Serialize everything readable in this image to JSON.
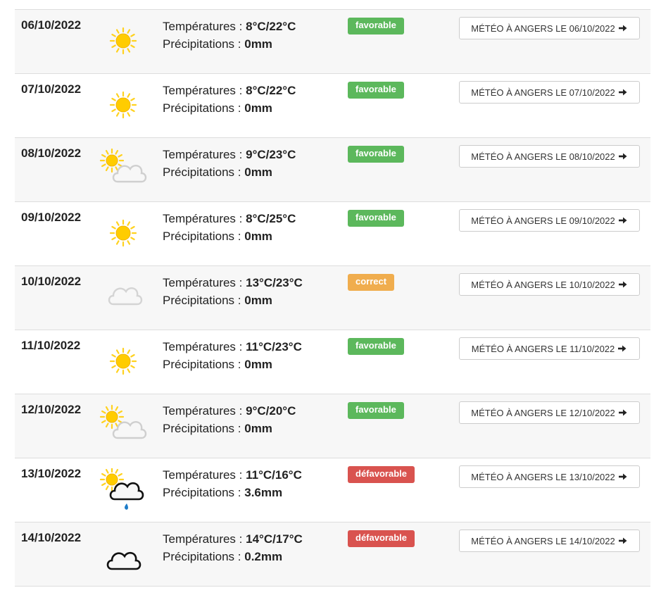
{
  "labels": {
    "temperatures": "Températures : ",
    "precipitations": "Précipitations : "
  },
  "colors": {
    "favorable": "#5cb85c",
    "correct": "#f0ad4e",
    "defavorable": "#d9534f",
    "sun": "#ffd21f",
    "rain": "#1e7cc8"
  },
  "rows": [
    {
      "date": "06/10/2022",
      "icon": "sun-icon",
      "temps": "8°C/22°C",
      "precip": "0mm",
      "status": "favorable",
      "status_label": "favorable",
      "button": "MÉTÉO À ANGERS LE 06/10/2022"
    },
    {
      "date": "07/10/2022",
      "icon": "sun-icon",
      "temps": "8°C/22°C",
      "precip": "0mm",
      "status": "favorable",
      "status_label": "favorable",
      "button": "MÉTÉO À ANGERS LE 07/10/2022"
    },
    {
      "date": "08/10/2022",
      "icon": "partly-cloudy-icon",
      "temps": "9°C/23°C",
      "precip": "0mm",
      "status": "favorable",
      "status_label": "favorable",
      "button": "MÉTÉO À ANGERS LE 08/10/2022"
    },
    {
      "date": "09/10/2022",
      "icon": "sun-icon",
      "temps": "8°C/25°C",
      "precip": "0mm",
      "status": "favorable",
      "status_label": "favorable",
      "button": "MÉTÉO À ANGERS LE 09/10/2022"
    },
    {
      "date": "10/10/2022",
      "icon": "light-cloud-icon",
      "temps": "13°C/23°C",
      "precip": "0mm",
      "status": "correct",
      "status_label": "correct",
      "button": "MÉTÉO À ANGERS LE 10/10/2022"
    },
    {
      "date": "11/10/2022",
      "icon": "sun-icon",
      "temps": "11°C/23°C",
      "precip": "0mm",
      "status": "favorable",
      "status_label": "favorable",
      "button": "MÉTÉO À ANGERS LE 11/10/2022"
    },
    {
      "date": "12/10/2022",
      "icon": "partly-cloudy-icon",
      "temps": "9°C/20°C",
      "precip": "0mm",
      "status": "favorable",
      "status_label": "favorable",
      "button": "MÉTÉO À ANGERS LE 12/10/2022"
    },
    {
      "date": "13/10/2022",
      "icon": "sun-rain-cloud-icon",
      "temps": "11°C/16°C",
      "precip": "3.6mm",
      "status": "defavorable",
      "status_label": "défavorable",
      "button": "MÉTÉO À ANGERS LE 13/10/2022"
    },
    {
      "date": "14/10/2022",
      "icon": "dark-cloud-icon",
      "temps": "14°C/17°C",
      "precip": "0.2mm",
      "status": "defavorable",
      "status_label": "défavorable",
      "button": "MÉTÉO À ANGERS LE 14/10/2022"
    }
  ]
}
